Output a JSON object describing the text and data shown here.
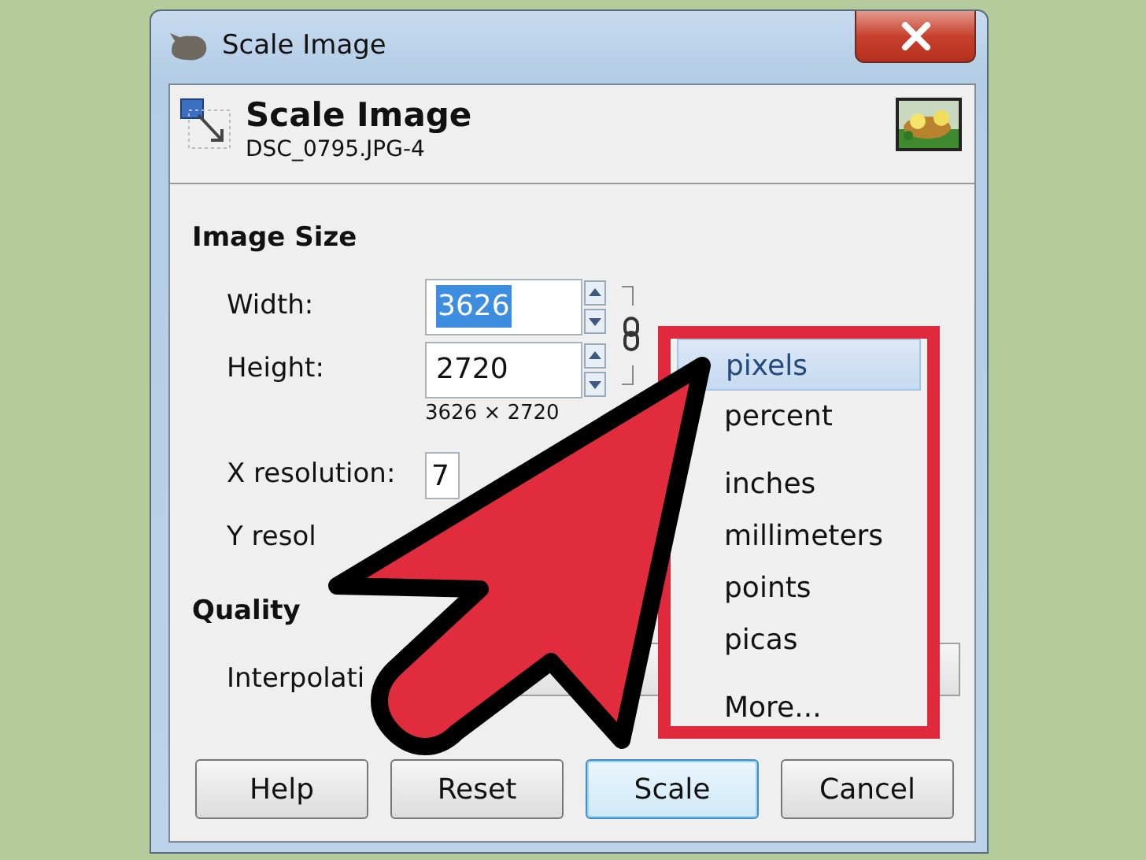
{
  "window": {
    "title": "Scale Image"
  },
  "header": {
    "title": "Scale Image",
    "subtitle": "DSC_0795.JPG-4"
  },
  "image_size": {
    "heading": "Image Size",
    "fields": [
      {
        "label": "Width:",
        "value": "3626",
        "text_selected": true
      },
      {
        "label": "Height:",
        "value": "2720",
        "text_selected": false
      }
    ],
    "chain_linked": true,
    "size_note": "3626 × 2720",
    "x_resolution": {
      "label": "X resolution:",
      "value": "7"
    },
    "y_resolution": {
      "label": "Y resol"
    }
  },
  "quality": {
    "heading": "Quality",
    "interpolation_label": "Interpolati"
  },
  "buttons": [
    {
      "label": "Help",
      "focused": false
    },
    {
      "label": "Reset",
      "focused": false
    },
    {
      "label": "Scale",
      "focused": true
    },
    {
      "label": "Cancel",
      "focused": false
    }
  ],
  "units_menu": [
    {
      "kind": "item",
      "label": "pixels",
      "selected": true
    },
    {
      "kind": "item",
      "label": "percent",
      "selected": false
    },
    {
      "kind": "separator"
    },
    {
      "kind": "item",
      "label": "inches",
      "selected": false
    },
    {
      "kind": "item",
      "label": "millimeters",
      "selected": false
    },
    {
      "kind": "item",
      "label": "points",
      "selected": false
    },
    {
      "kind": "item",
      "label": "picas",
      "selected": false
    },
    {
      "kind": "separator"
    },
    {
      "kind": "item",
      "label": "More...",
      "selected": false
    }
  ],
  "annotations": {
    "arrow": true,
    "highlight_box": true
  }
}
